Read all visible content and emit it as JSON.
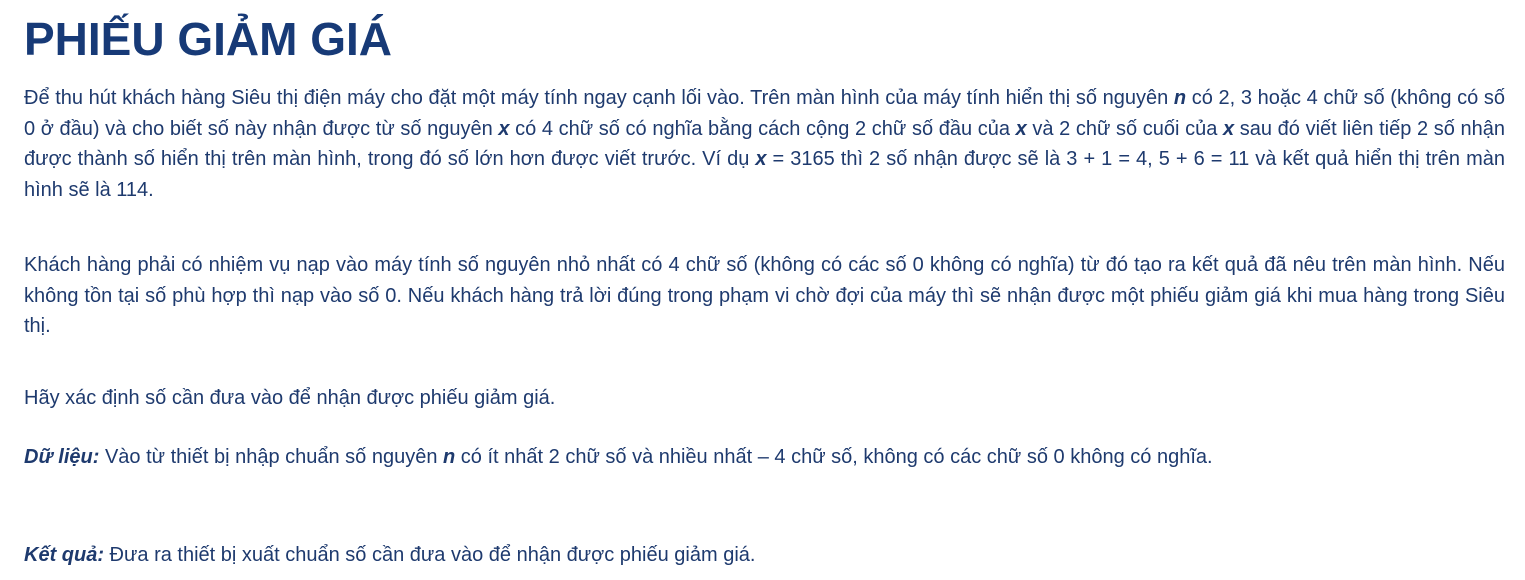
{
  "title": "PHIẾU GIẢM GIÁ",
  "p1": {
    "s1": "Để thu hút khách hàng Siêu thị điện máy cho đặt một máy tính ngay cạnh lối vào. Trên màn hình của máy tính hiển thị số nguyên ",
    "v1": "n",
    "s2": " có 2, 3 hoặc 4 chữ số (không có số 0 ở đầu) và cho biết số này nhận được từ số nguyên ",
    "v2": "x",
    "s3": " có 4 chữ số có nghĩa bằng cách cộng 2 chữ số đầu của ",
    "v3": "x",
    "s4": " và 2 chữ số cuối của ",
    "v4": "x",
    "s5": " sau đó viết liên tiếp 2 số nhận được thành số hiển thị trên màn hình, trong đó số lớn hơn được viết trước. Ví dụ ",
    "v5": "x",
    "s6": " = 3165 thì 2 số nhận được sẽ là 3 + 1 = 4, 5 + 6 = 11 và kết quả hiển thị trên màn hình sẽ là 114."
  },
  "p2": "Khách hàng phải có nhiệm vụ nạp vào máy tính số nguyên nhỏ nhất có 4 chữ số (không có các số 0 không có nghĩa) từ đó tạo ra kết quả đã nêu trên màn hình. Nếu không tồn tại số phù hợp thì nạp vào số 0. Nếu khách hàng trả lời đúng trong phạm vi chờ đợi của máy thì sẽ nhận được một phiếu giảm giá khi mua hàng trong Siêu thị.",
  "p3": "Hãy xác định số cần đưa vào để nhận được phiếu giảm giá.",
  "p4": {
    "label": "Dữ liệu:",
    "s1": " Vào từ thiết bị nhập chuẩn số nguyên ",
    "v1": "n",
    "s2": " có ít nhất 2 chữ số và nhiều nhất – 4 chữ số, không có các chữ số 0 không có nghĩa."
  },
  "p5": {
    "label": "Kết quả:",
    "s1": " Đưa ra thiết bị xuất chuẩn số cần đưa vào để nhận được phiếu giảm giá."
  }
}
